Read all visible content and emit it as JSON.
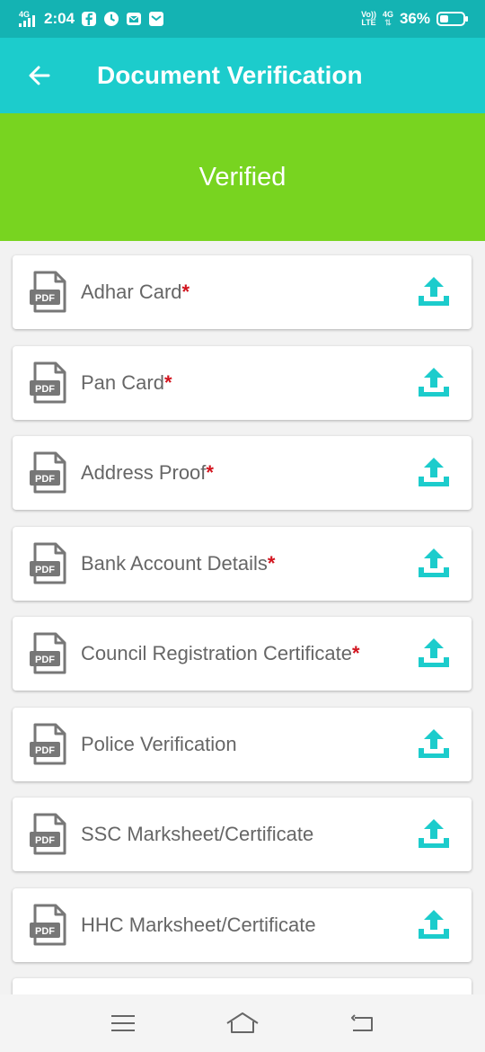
{
  "status_bar": {
    "network_left": "4G",
    "time": "2:04",
    "volte": "Vo))",
    "lte": "LTE",
    "network_right": "4G",
    "battery": "36%"
  },
  "app_bar": {
    "back_icon": "arrow-left-icon",
    "title": "Document Verification"
  },
  "banner": {
    "text": "Verified"
  },
  "documents": [
    {
      "label": "Adhar Card",
      "required": "*"
    },
    {
      "label": "Pan Card",
      "required": "*"
    },
    {
      "label": "Address Proof",
      "required": "*"
    },
    {
      "label": "Bank Account Details",
      "required": "*"
    },
    {
      "label": "Council Registration Certificate",
      "required": "*"
    },
    {
      "label": "Police Verification",
      "required": ""
    },
    {
      "label": "SSC Marksheet/Certificate",
      "required": ""
    },
    {
      "label": "HHC Marksheet/Certificate",
      "required": ""
    }
  ],
  "pdf_badge": "PDF",
  "colors": {
    "status_bar": "#14b3b3",
    "app_bar": "#1ccccc",
    "verified": "#78d420",
    "upload_icon": "#1ccccc",
    "required_mark": "#d2141e"
  },
  "nav": {
    "menu_icon": "menu-icon",
    "home_icon": "home-icon",
    "back_icon": "back-icon"
  }
}
